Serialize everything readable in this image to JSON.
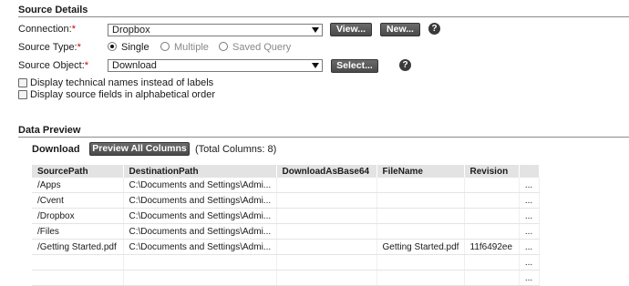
{
  "source_details": {
    "title": "Source Details",
    "connection": {
      "label": "Connection:",
      "required": "*",
      "value": "Dropbox",
      "view_button": "View...",
      "new_button": "New...",
      "help": "?"
    },
    "source_type": {
      "label": "Source Type:",
      "required": "*",
      "options": [
        "Single",
        "Multiple",
        "Saved Query"
      ],
      "selected": "Single"
    },
    "source_object": {
      "label": "Source Object:",
      "required": "*",
      "value": "Download",
      "select_button": "Select...",
      "help": "?"
    },
    "checkboxes": [
      "Display technical names instead of labels",
      "Display source fields in alphabetical order"
    ]
  },
  "data_preview": {
    "title": "Data Preview",
    "object_name": "Download",
    "preview_button": "Preview All Columns",
    "total_columns": "(Total Columns: 8)",
    "columns": [
      "SourcePath",
      "DestinationPath",
      "DownloadAsBase64",
      "FileName",
      "Revision",
      ""
    ],
    "rows": [
      [
        "/Apps",
        "C:\\Documents and Settings\\Admi...",
        "",
        "",
        "",
        "..."
      ],
      [
        "/Cvent",
        "C:\\Documents and Settings\\Admi...",
        "",
        "",
        "",
        "..."
      ],
      [
        "/Dropbox",
        "C:\\Documents and Settings\\Admi...",
        "",
        "",
        "",
        "..."
      ],
      [
        "/Files",
        "C:\\Documents and Settings\\Admi...",
        "",
        "",
        "",
        "..."
      ],
      [
        "/Getting Started.pdf",
        "C:\\Documents and Settings\\Admi...",
        "",
        "Getting Started.pdf",
        "11f6492ee",
        "..."
      ],
      [
        "",
        "",
        "",
        "",
        "",
        "..."
      ],
      [
        "",
        "",
        "",
        "",
        "",
        "..."
      ]
    ]
  }
}
